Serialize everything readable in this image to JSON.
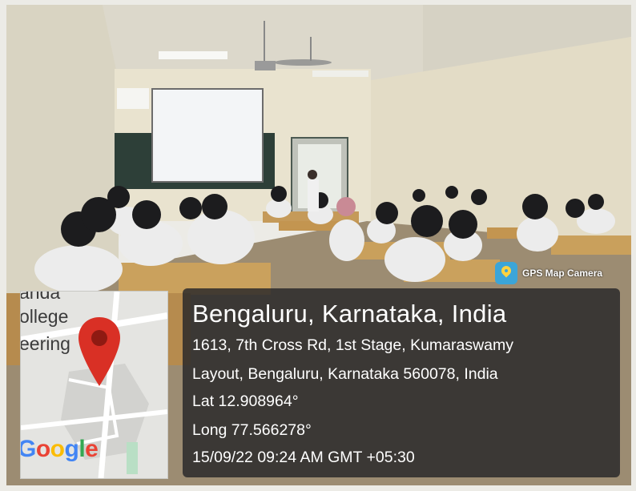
{
  "photo": {
    "description_colors": {
      "wall": "#e6e0cc",
      "floor": "#9b8a70",
      "desk": "#c89a55",
      "screen": "#f2f4f6"
    }
  },
  "overlay": {
    "badge_label": "GPS Map Camera",
    "icon": "gps-map-camera-icon",
    "place_title": "Bengaluru, Karnataka, India",
    "address_line1": "1613, 7th Cross Rd, 1st Stage, Kumaraswamy",
    "address_line2": "Layout, Bengaluru, Karnataka 560078, India",
    "latitude": "Lat 12.908964°",
    "longitude": "Long 77.566278°",
    "timestamp": "15/09/22 09:24 AM GMT +05:30"
  },
  "map": {
    "label_top": "anda",
    "label_mid": "ollege",
    "label_low": "eering",
    "pin_icon": "map-pin-icon",
    "pin_color": "#d93025",
    "logo": "Google"
  }
}
